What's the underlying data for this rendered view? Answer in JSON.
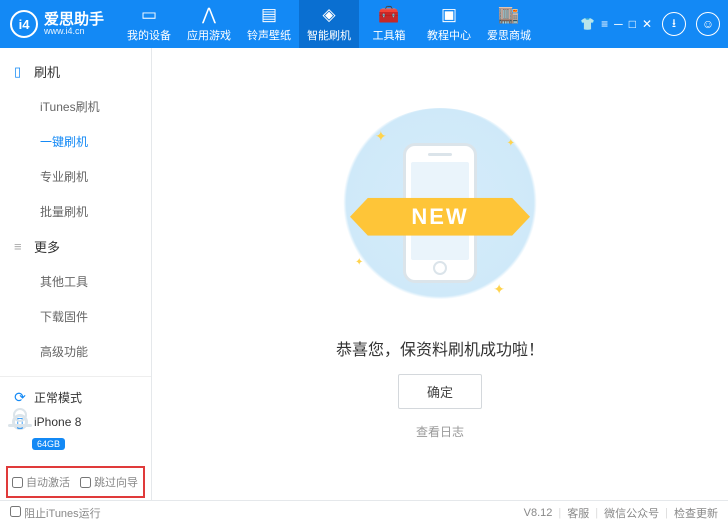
{
  "brand": {
    "logo": "i4",
    "name": "爱思助手",
    "url": "www.i4.cn"
  },
  "nav": [
    {
      "label": "我的设备"
    },
    {
      "label": "应用游戏"
    },
    {
      "label": "铃声壁纸"
    },
    {
      "label": "智能刷机",
      "active": true
    },
    {
      "label": "工具箱"
    },
    {
      "label": "教程中心"
    },
    {
      "label": "爱思商城"
    }
  ],
  "sidebar": {
    "groups": [
      {
        "title": "刷机",
        "items": [
          {
            "label": "iTunes刷机"
          },
          {
            "label": "一键刷机",
            "active": true
          },
          {
            "label": "专业刷机"
          },
          {
            "label": "批量刷机"
          }
        ]
      },
      {
        "title": "更多",
        "items": [
          {
            "label": "其他工具"
          },
          {
            "label": "下载固件"
          },
          {
            "label": "高级功能"
          }
        ]
      }
    ],
    "mode": "正常模式",
    "device": "iPhone 8",
    "storage": "64GB",
    "opts": {
      "a": "自动激活",
      "b": "跳过向导"
    }
  },
  "content": {
    "banner": "NEW",
    "message": "恭喜您，保资料刷机成功啦！",
    "confirm": "确定",
    "log": "查看日志"
  },
  "status": {
    "block": "阻止iTunes运行",
    "version": "V8.12",
    "support": "客服",
    "wechat": "微信公众号",
    "update": "检查更新"
  }
}
